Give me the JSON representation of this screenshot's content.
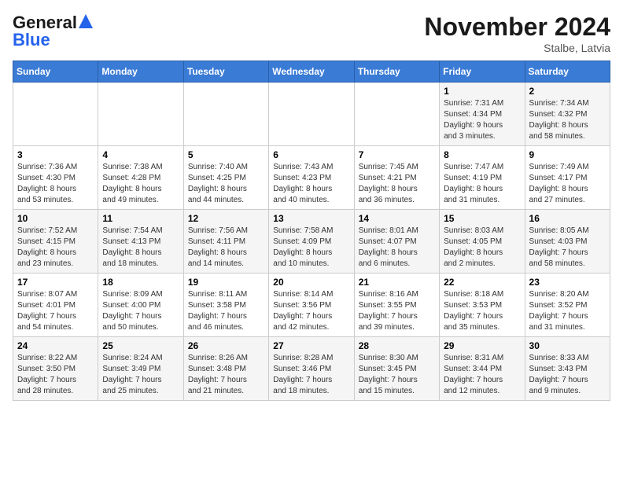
{
  "logo": {
    "line1": "General",
    "line2": "Blue"
  },
  "title": "November 2024",
  "location": "Stalbe, Latvia",
  "weekdays": [
    "Sunday",
    "Monday",
    "Tuesday",
    "Wednesday",
    "Thursday",
    "Friday",
    "Saturday"
  ],
  "weeks": [
    [
      {
        "day": "",
        "info": ""
      },
      {
        "day": "",
        "info": ""
      },
      {
        "day": "",
        "info": ""
      },
      {
        "day": "",
        "info": ""
      },
      {
        "day": "",
        "info": ""
      },
      {
        "day": "1",
        "info": "Sunrise: 7:31 AM\nSunset: 4:34 PM\nDaylight: 9 hours\nand 3 minutes."
      },
      {
        "day": "2",
        "info": "Sunrise: 7:34 AM\nSunset: 4:32 PM\nDaylight: 8 hours\nand 58 minutes."
      }
    ],
    [
      {
        "day": "3",
        "info": "Sunrise: 7:36 AM\nSunset: 4:30 PM\nDaylight: 8 hours\nand 53 minutes."
      },
      {
        "day": "4",
        "info": "Sunrise: 7:38 AM\nSunset: 4:28 PM\nDaylight: 8 hours\nand 49 minutes."
      },
      {
        "day": "5",
        "info": "Sunrise: 7:40 AM\nSunset: 4:25 PM\nDaylight: 8 hours\nand 44 minutes."
      },
      {
        "day": "6",
        "info": "Sunrise: 7:43 AM\nSunset: 4:23 PM\nDaylight: 8 hours\nand 40 minutes."
      },
      {
        "day": "7",
        "info": "Sunrise: 7:45 AM\nSunset: 4:21 PM\nDaylight: 8 hours\nand 36 minutes."
      },
      {
        "day": "8",
        "info": "Sunrise: 7:47 AM\nSunset: 4:19 PM\nDaylight: 8 hours\nand 31 minutes."
      },
      {
        "day": "9",
        "info": "Sunrise: 7:49 AM\nSunset: 4:17 PM\nDaylight: 8 hours\nand 27 minutes."
      }
    ],
    [
      {
        "day": "10",
        "info": "Sunrise: 7:52 AM\nSunset: 4:15 PM\nDaylight: 8 hours\nand 23 minutes."
      },
      {
        "day": "11",
        "info": "Sunrise: 7:54 AM\nSunset: 4:13 PM\nDaylight: 8 hours\nand 18 minutes."
      },
      {
        "day": "12",
        "info": "Sunrise: 7:56 AM\nSunset: 4:11 PM\nDaylight: 8 hours\nand 14 minutes."
      },
      {
        "day": "13",
        "info": "Sunrise: 7:58 AM\nSunset: 4:09 PM\nDaylight: 8 hours\nand 10 minutes."
      },
      {
        "day": "14",
        "info": "Sunrise: 8:01 AM\nSunset: 4:07 PM\nDaylight: 8 hours\nand 6 minutes."
      },
      {
        "day": "15",
        "info": "Sunrise: 8:03 AM\nSunset: 4:05 PM\nDaylight: 8 hours\nand 2 minutes."
      },
      {
        "day": "16",
        "info": "Sunrise: 8:05 AM\nSunset: 4:03 PM\nDaylight: 7 hours\nand 58 minutes."
      }
    ],
    [
      {
        "day": "17",
        "info": "Sunrise: 8:07 AM\nSunset: 4:01 PM\nDaylight: 7 hours\nand 54 minutes."
      },
      {
        "day": "18",
        "info": "Sunrise: 8:09 AM\nSunset: 4:00 PM\nDaylight: 7 hours\nand 50 minutes."
      },
      {
        "day": "19",
        "info": "Sunrise: 8:11 AM\nSunset: 3:58 PM\nDaylight: 7 hours\nand 46 minutes."
      },
      {
        "day": "20",
        "info": "Sunrise: 8:14 AM\nSunset: 3:56 PM\nDaylight: 7 hours\nand 42 minutes."
      },
      {
        "day": "21",
        "info": "Sunrise: 8:16 AM\nSunset: 3:55 PM\nDaylight: 7 hours\nand 39 minutes."
      },
      {
        "day": "22",
        "info": "Sunrise: 8:18 AM\nSunset: 3:53 PM\nDaylight: 7 hours\nand 35 minutes."
      },
      {
        "day": "23",
        "info": "Sunrise: 8:20 AM\nSunset: 3:52 PM\nDaylight: 7 hours\nand 31 minutes."
      }
    ],
    [
      {
        "day": "24",
        "info": "Sunrise: 8:22 AM\nSunset: 3:50 PM\nDaylight: 7 hours\nand 28 minutes."
      },
      {
        "day": "25",
        "info": "Sunrise: 8:24 AM\nSunset: 3:49 PM\nDaylight: 7 hours\nand 25 minutes."
      },
      {
        "day": "26",
        "info": "Sunrise: 8:26 AM\nSunset: 3:48 PM\nDaylight: 7 hours\nand 21 minutes."
      },
      {
        "day": "27",
        "info": "Sunrise: 8:28 AM\nSunset: 3:46 PM\nDaylight: 7 hours\nand 18 minutes."
      },
      {
        "day": "28",
        "info": "Sunrise: 8:30 AM\nSunset: 3:45 PM\nDaylight: 7 hours\nand 15 minutes."
      },
      {
        "day": "29",
        "info": "Sunrise: 8:31 AM\nSunset: 3:44 PM\nDaylight: 7 hours\nand 12 minutes."
      },
      {
        "day": "30",
        "info": "Sunrise: 8:33 AM\nSunset: 3:43 PM\nDaylight: 7 hours\nand 9 minutes."
      }
    ]
  ]
}
